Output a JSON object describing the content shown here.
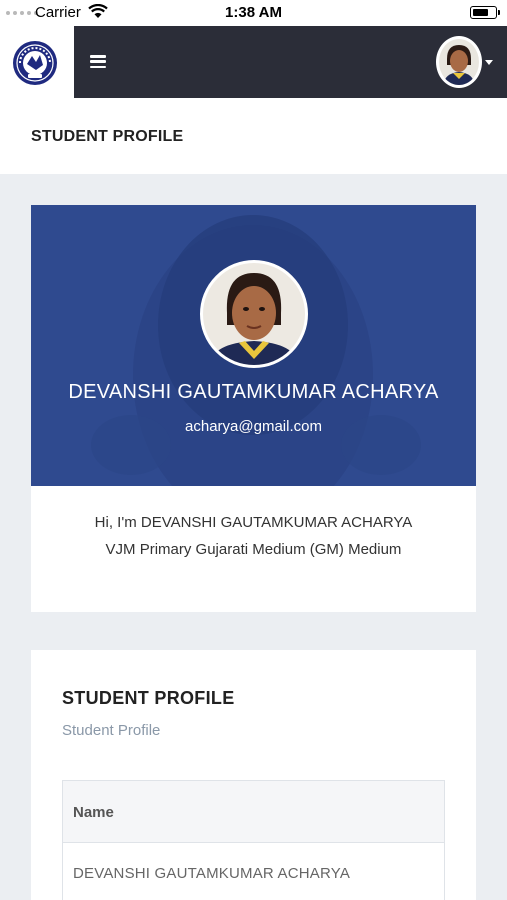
{
  "status_bar": {
    "carrier": "Carrier",
    "time": "1:38 AM",
    "battery_level": 0.75
  },
  "navbar": {
    "logo_icon": "school-logo-icon",
    "menu_icon": "hamburger-menu-icon",
    "avatar_icon": "student-avatar",
    "dropdown_icon": "caret-down-icon",
    "color": "#2b2d38"
  },
  "page": {
    "title": "STUDENT PROFILE"
  },
  "profile_card": {
    "name": "DEVANSHI GAUTAMKUMAR ACHARYA",
    "email": "acharya@gmail.com",
    "intro_line1": "Hi, I'm DEVANSHI GAUTAMKUMAR ACHARYA",
    "intro_line2": "VJM Primary Gujarati Medium (GM) Medium",
    "hero_color": "#2f4a8f"
  },
  "detail_card": {
    "title": "STUDENT PROFILE",
    "subtitle": "Student Profile",
    "table": {
      "header": "Name",
      "value": "DEVANSHI GAUTAMKUMAR ACHARYA"
    }
  }
}
